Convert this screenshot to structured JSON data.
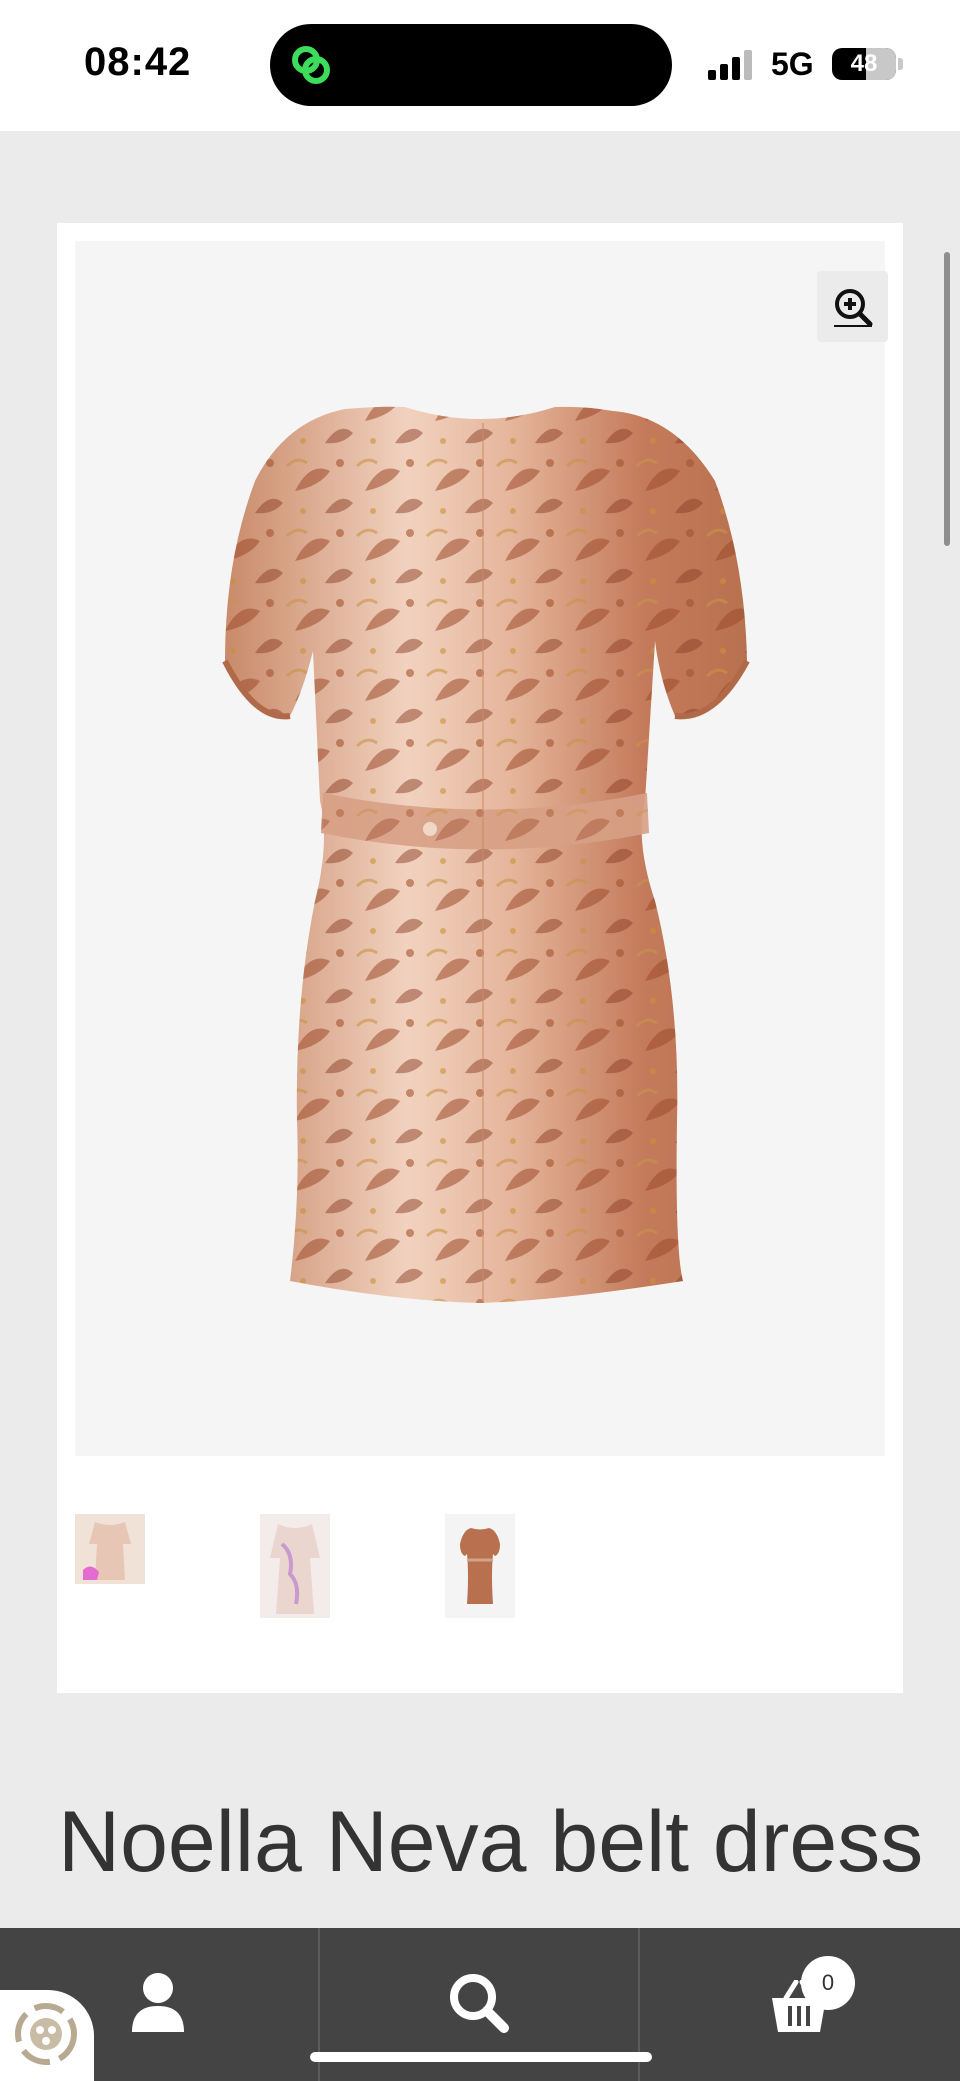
{
  "status_bar": {
    "time": "08:42",
    "network": "5G",
    "battery_level": "48",
    "battery_fraction": 0.48
  },
  "gallery": {
    "zoom_icon": "zoom-in-icon",
    "main_image_alt": "dress-back-view",
    "thumbnails": [
      {
        "name": "thumbnail-1"
      },
      {
        "name": "thumbnail-2"
      },
      {
        "name": "thumbnail-3"
      }
    ]
  },
  "product": {
    "title": "Noella Neva belt dress"
  },
  "bottom_nav": {
    "items": [
      {
        "icon": "account-icon"
      },
      {
        "icon": "search-icon"
      },
      {
        "icon": "cart-icon"
      }
    ],
    "cart_count": "0"
  },
  "colors": {
    "nav_background": "#444444",
    "page_background": "#ebebeb",
    "title_text": "#333333",
    "dress_base": "#d9a58a",
    "dress_pattern": "#9c4a2c"
  }
}
